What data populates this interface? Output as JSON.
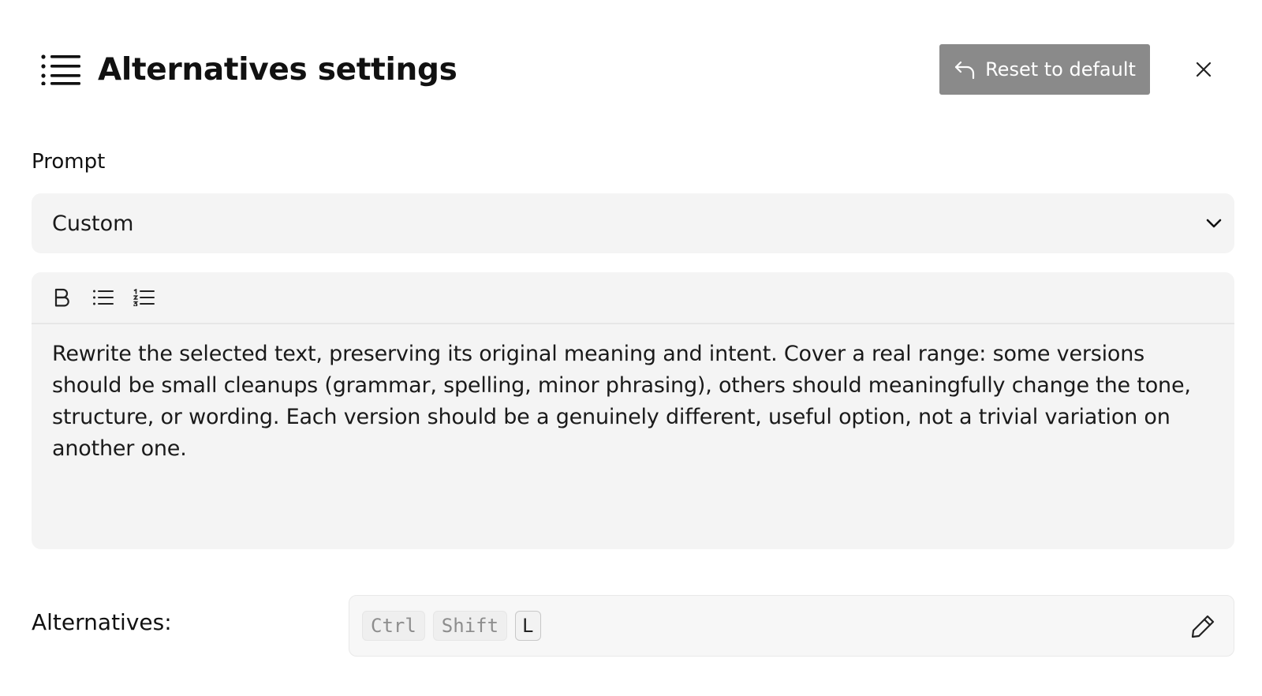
{
  "header": {
    "title": "Alternatives settings",
    "icon": "list-icon",
    "reset_label": "Reset to default",
    "reset_icon": "undo-arrow-icon",
    "close_icon": "close-icon"
  },
  "prompt": {
    "label": "Prompt",
    "selected": "Custom",
    "chevron_icon": "chevron-down-icon"
  },
  "editor": {
    "toolbar": [
      "bold-icon",
      "bullet-list-icon",
      "numbered-list-icon"
    ],
    "text": "Rewrite the selected text, preserving its original meaning and intent. Cover a real range: some versions should be small cleanups (grammar, spelling, minor phrasing), others should meaningfully change the tone, structure, or wording. Each version should be a genuinely different, useful option, not a trivial variation on another one."
  },
  "shortcut": {
    "label": "Alternatives:",
    "keys": [
      "Ctrl",
      "Shift",
      "L"
    ],
    "edit_icon": "pencil-icon"
  },
  "colors": {
    "reset_button_bg": "#8a8a8a",
    "field_bg": "#f4f4f4",
    "text": "#111111"
  }
}
